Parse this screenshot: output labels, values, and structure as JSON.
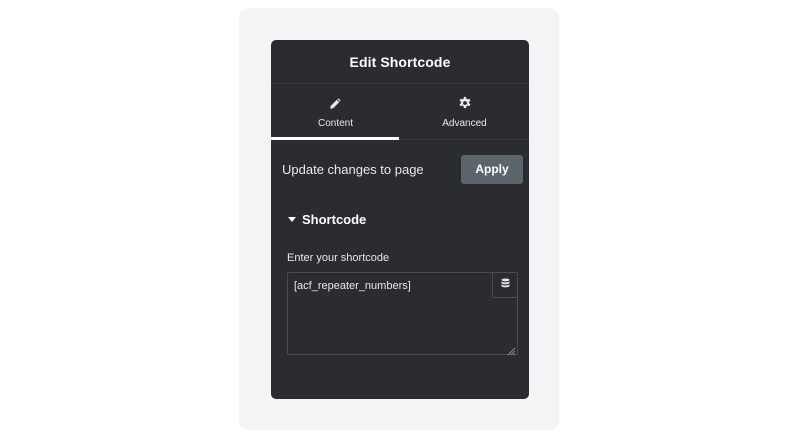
{
  "panel": {
    "title": "Edit Shortcode"
  },
  "tabs": [
    {
      "label": "Content",
      "icon": "pencil-icon",
      "active": true
    },
    {
      "label": "Advanced",
      "icon": "gear-icon",
      "active": false
    }
  ],
  "apply_row": {
    "text": "Update changes to page",
    "button_label": "Apply"
  },
  "section": {
    "title": "Shortcode",
    "expanded": true
  },
  "shortcode_field": {
    "label": "Enter your shortcode",
    "value": "[acf_repeater_numbers]",
    "dynamic_icon": "database-icon"
  },
  "colors": {
    "panel_background": "#2b2c30",
    "page_background": "#f3f4f6",
    "apply_button": "#5c646c",
    "active_tab_indicator": "#ffffff"
  }
}
